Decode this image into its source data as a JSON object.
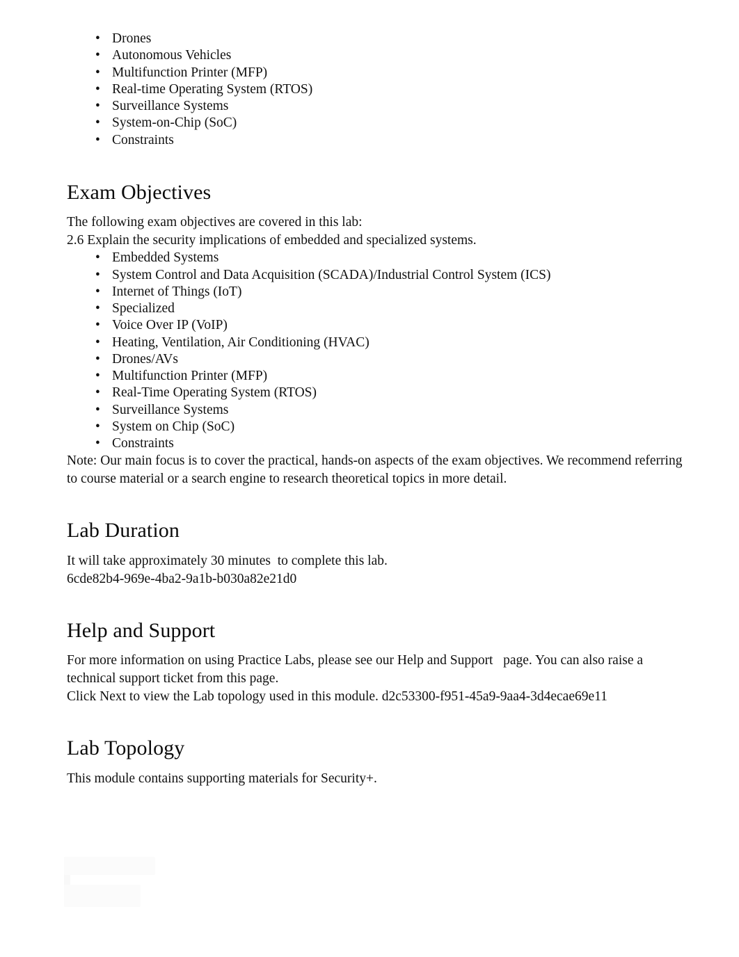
{
  "document": {
    "top_list": {
      "bullet_glyph": "•",
      "items": [
        "Drones",
        "Autonomous Vehicles",
        "Multifunction Printer (MFP)",
        "Real-time Operating System (RTOS)",
        "Surveillance Systems",
        "System-on-Chip (SoC)",
        "Constraints"
      ]
    },
    "exam_objectives": {
      "heading": "Exam Objectives",
      "intro": "The following exam objectives are covered in this lab:",
      "objective": "2.6 Explain the security implications of embedded and specialized systems.",
      "bullet_glyph": "•",
      "items": [
        "Embedded Systems",
        "System Control and Data Acquisition (SCADA)/Industrial Control System (ICS)",
        "Internet of Things (IoT)",
        "Specialized",
        "Voice Over IP (VoIP)",
        "Heating, Ventilation, Air Conditioning (HVAC)",
        "Drones/AVs",
        "Multifunction Printer (MFP)",
        "Real-Time Operating System (RTOS)",
        "Surveillance Systems",
        "System on Chip (SoC)",
        "Constraints"
      ],
      "note": "Note: Our main focus is to cover the practical, hands-on aspects of the exam objectives. We recommend referring to course material or a search engine to research theoretical topics in more detail."
    },
    "lab_duration": {
      "heading": "Lab Duration",
      "text": "It will take approximately 30 minutes  to complete this lab.",
      "duration_value": "30 minutes",
      "identifier": "6cde82b4-969e-4ba2-9a1b-b030a82e21d0"
    },
    "help_and_support": {
      "heading": "Help and Support",
      "paragraph": "For more information on using Practice Labs, please see our Help and Support   page. You can also raise a technical support ticket from this page.",
      "link_label": "Help and Support",
      "next_line": "Click Next to view the Lab topology used in this module. d2c53300-f951-45a9-9aa4-3d4ecae69e11",
      "identifier": "d2c53300-f951-45a9-9aa4-3d4ecae69e11"
    },
    "lab_topology": {
      "heading": "Lab Topology",
      "text": "This module contains supporting materials for Security+."
    }
  }
}
